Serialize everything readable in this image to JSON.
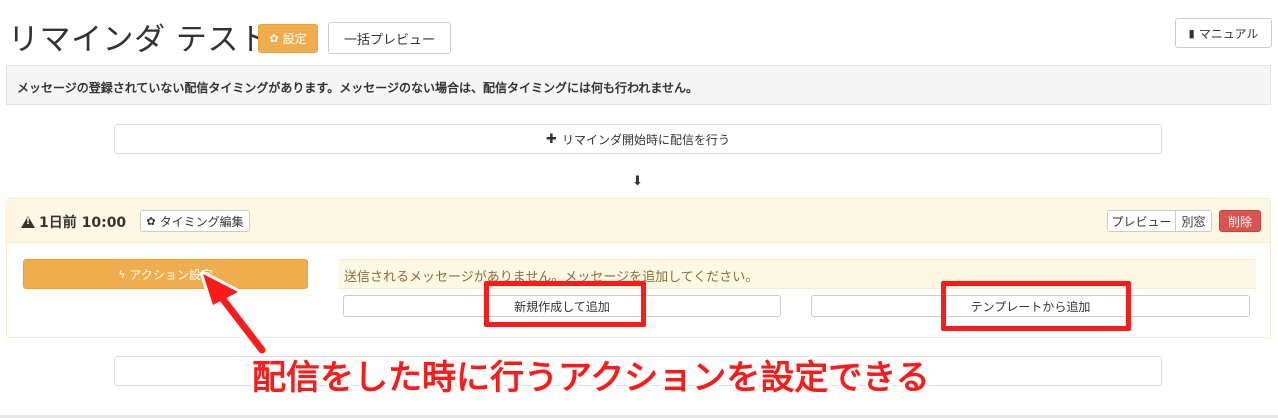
{
  "header": {
    "title": "リマインダ テスト",
    "settings_label": "設定",
    "bulk_preview_label": "一括プレビュー",
    "manual_label": "マニュアル"
  },
  "notice": {
    "text": "メッセージの登録されていない配信タイミングがあります。メッセージのない場合は、配信タイミングには何も行われません。"
  },
  "add_start": {
    "label": "リマインダ開始時に配信を行う"
  },
  "timing": {
    "label": "1日前 10:00",
    "edit_label": "タイミング編集",
    "preview_label": "プレビュー",
    "window_label": "別窓",
    "delete_label": "削除",
    "action_label": "アクション設定",
    "no_message_text": "送信されるメッセージがありません。メッセージを追加してください。",
    "new_label": "新規作成して追加",
    "template_label": "テンプレートから追加"
  },
  "annotation": {
    "text": "配信をした時に行うアクションを設定できる",
    "color": "#ff1a1a"
  },
  "icons": {
    "settings": "gear-icon",
    "manual": "book-icon",
    "add": "plus-icon",
    "arrow": "arrow-down-icon",
    "warning": "warning-icon",
    "action": "bolt-icon"
  },
  "colors": {
    "warning_button": "#f0ad4e",
    "danger_button": "#d9534f",
    "panel_heading": "#fcf8e3",
    "annotation_red": "#ff1a1a"
  }
}
